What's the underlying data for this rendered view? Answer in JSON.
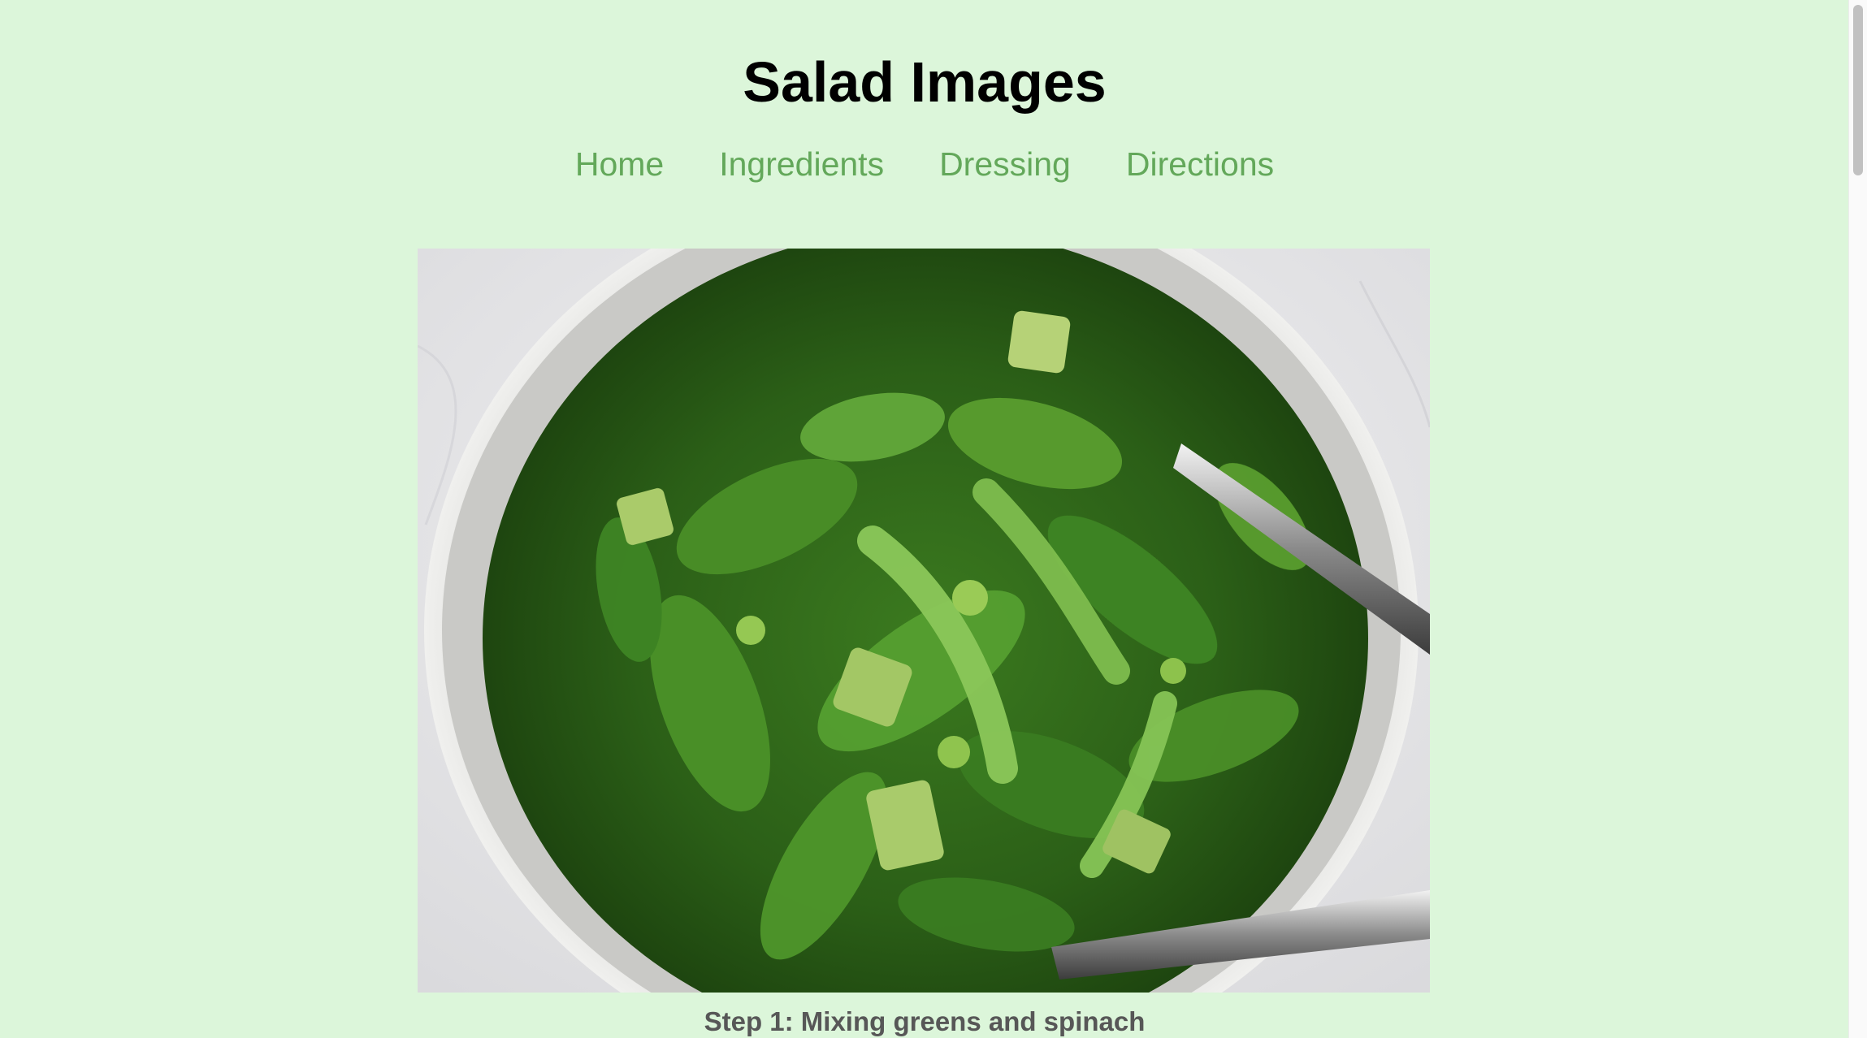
{
  "page": {
    "title": "Salad Images"
  },
  "nav": {
    "items": [
      {
        "label": "Home"
      },
      {
        "label": "Ingredients"
      },
      {
        "label": "Dressing"
      },
      {
        "label": "Directions"
      }
    ]
  },
  "gallery": {
    "image_alt": "Bowl of green salad with spinach, avocado, snap peas and serving tongs",
    "caption": "Step 1: Mixing greens and spinach"
  },
  "colors": {
    "background": "#dcf6da",
    "nav_link": "#63a85a",
    "caption": "#575757",
    "title": "#000000"
  }
}
